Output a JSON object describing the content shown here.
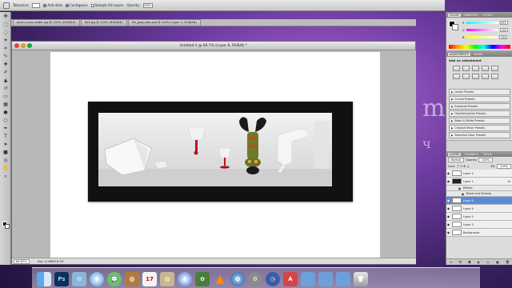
{
  "options_bar": {
    "tolerance_label": "Tolerance:",
    "tolerance_value": "32",
    "anti_alias_label": "Anti-alias",
    "contiguous_label": "Contiguous",
    "sample_all_layers_label": "Sample All Layers",
    "opacity_label": "Opacity:",
    "opacity_value": "100%"
  },
  "document_tabs": [
    "plush-crazy-rabbit.jpg @ 100% (RGB/8#)",
    "843.jpg @ 100% (RGB/8#)",
    "file_jpeg-sofa.psd @ 100% (Layer 3, RGB/8#)"
  ],
  "document": {
    "title": "Untitled-1 @ 66.7% (Layer 6, RGB/8) *",
    "zoom": "66.67%",
    "doc_size": "Doc: 4.58M/18.7M"
  },
  "color_panel": {
    "tabs": [
      "COLOR",
      "SWATCHES",
      "STYLES"
    ],
    "r_label": "R",
    "r_value": "255",
    "g_label": "G",
    "g_value": "255",
    "b_label": "B",
    "b_value": "255"
  },
  "adjustments": {
    "tabs": [
      "ADJUSTMENTS",
      "MASKS"
    ],
    "heading": "Add an adjustment",
    "presets": [
      "Levels Presets",
      "Curves Presets",
      "Exposure Presets",
      "Hue/Saturation Presets",
      "Black & White Presets",
      "Channel Mixer Presets",
      "Selective Color Presets"
    ]
  },
  "layers": {
    "tabs": [
      "LAYERS",
      "CHANNELS",
      "PATHS"
    ],
    "blend_mode": "Normal",
    "opacity_label": "Opacity:",
    "opacity_value": "100%",
    "lock_label": "Lock:",
    "fill_label": "Fill:",
    "fill_value": "100%",
    "items": [
      {
        "name": "Layer 2",
        "selected": false
      },
      {
        "name": "Layer 1",
        "selected": false,
        "fx": true
      },
      {
        "name": "Effects",
        "selected": false,
        "sub": true
      },
      {
        "name": "Bevel and Emboss",
        "selected": false,
        "sub": true
      },
      {
        "name": "Layer 6",
        "selected": true
      },
      {
        "name": "Layer 4",
        "selected": false
      },
      {
        "name": "Layer 5",
        "selected": false
      },
      {
        "name": "Layer 3",
        "selected": false
      },
      {
        "name": "Background",
        "selected": false
      }
    ]
  },
  "dock": {
    "ps_label": "Ps"
  },
  "colors": {
    "selected_layer": "#5b8bd8",
    "blood_red": "#c0121c"
  }
}
